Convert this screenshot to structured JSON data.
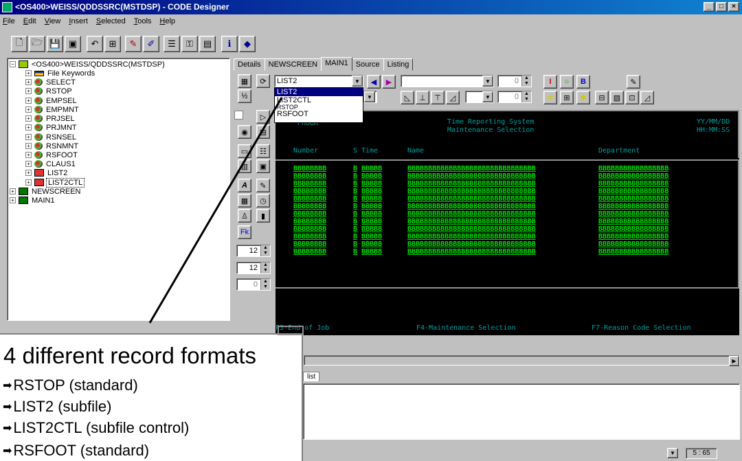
{
  "window": {
    "title": "<OS400>WEISS/QDDSSRC(MSTDSP) - CODE Designer",
    "buttons": [
      "_",
      "□",
      "×"
    ]
  },
  "menu": [
    "File",
    "Edit",
    "View",
    "Insert",
    "Selected",
    "Tools",
    "Help"
  ],
  "tree": {
    "root": "<OS400>WEISS/QDDSSRC(MSTDSP)",
    "children": [
      "File Keywords",
      "SELECT",
      "RSTOP",
      "EMPSEL",
      "EMPMNT",
      "PRJSEL",
      "PRJMNT",
      "RSNSEL",
      "RSNMNT",
      "RSFOOT",
      "CLAUS1",
      "LIST2",
      "LIST2CTL"
    ],
    "siblings": [
      "NEWSCREEN",
      "MAIN1"
    ],
    "selected": "LIST2CTL"
  },
  "tabs": [
    {
      "label": "Details",
      "active": false
    },
    {
      "label": "NEWSCREEN",
      "active": false
    },
    {
      "label": "MAIN1",
      "active": true
    },
    {
      "label": "Source",
      "active": false
    },
    {
      "label": "Listing",
      "active": false
    }
  ],
  "record_combo": {
    "value": "LIST2"
  },
  "dropdown": {
    "options": [
      "LIST2",
      "LIST2CTL",
      "RSTOP",
      "RSFOOT"
    ],
    "highlighted": "LIST2"
  },
  "spinners": {
    "row": "0",
    "col": "0",
    "height": "12",
    "width": "12",
    "other": "0"
  },
  "screen": {
    "header_left": "PROGR",
    "title1": "Time Reporting System",
    "title2": "Maintenance Selection",
    "date": "YY/MM/DD",
    "time": "HH:MM:SS",
    "col_number": "Number",
    "col_s": "S",
    "col_time": "Time",
    "col_name": "Name",
    "col_dept": "Department",
    "row_number": "BBBBBBBB",
    "row_s": "B",
    "row_time": "BBBBB",
    "row_name": "BBBBBBBBBBBBBBBBBBBBBBBBBBBBBBB",
    "row_dept": "BBBBBBBBBBBBBBBBB",
    "row_count": 12,
    "fkey1": "F3-End of Job",
    "fkey2": "F4-Maintenance Selection",
    "fkey3": "F7-Reason Code Selection"
  },
  "output_tab": "list",
  "status": {
    "cursor": "5 : 65"
  },
  "callout": {
    "heading": "4 different record formats",
    "items": [
      "RSTOP (standard)",
      "LIST2 (subfile)",
      "LIST2CTL (subfile control)",
      "RSFOOT (standard)"
    ]
  },
  "colors": {
    "title_bar": "#000080",
    "screen_bg": "#000000",
    "screen_cyan": "#00a0a0",
    "screen_green": "#00e000"
  }
}
